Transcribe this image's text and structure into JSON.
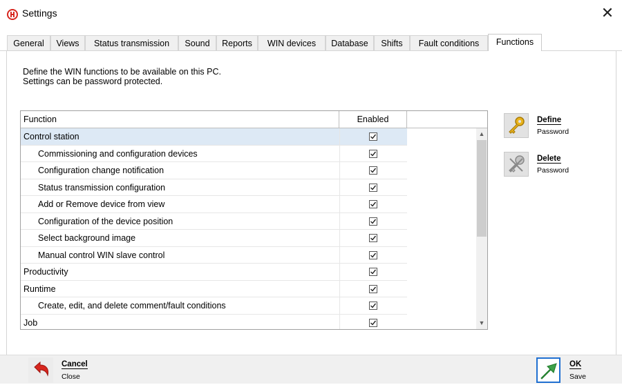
{
  "window": {
    "title": "Settings",
    "close_symbol": "✕"
  },
  "tabs": [
    {
      "label": "General"
    },
    {
      "label": "Views"
    },
    {
      "label": "Status transmission"
    },
    {
      "label": "Sound"
    },
    {
      "label": "Reports"
    },
    {
      "label": "WIN devices"
    },
    {
      "label": "Database"
    },
    {
      "label": "Shifts"
    },
    {
      "label": "Fault conditions"
    },
    {
      "label": "Functions",
      "active": true
    }
  ],
  "description": {
    "line1": "Define the WIN functions to be available on this PC.",
    "line2": "Settings can be password protected."
  },
  "table": {
    "headers": {
      "function": "Function",
      "enabled": "Enabled"
    },
    "rows": [
      {
        "label": "Control station",
        "child": false,
        "enabled": true,
        "selected": true
      },
      {
        "label": "Commissioning and configuration devices",
        "child": true,
        "enabled": true
      },
      {
        "label": "Configuration change notification",
        "child": true,
        "enabled": true
      },
      {
        "label": "Status transmission configuration",
        "child": true,
        "enabled": true
      },
      {
        "label": "Add or Remove device from view",
        "child": true,
        "enabled": true
      },
      {
        "label": "Configuration of the device position",
        "child": true,
        "enabled": true
      },
      {
        "label": "Select background image",
        "child": true,
        "enabled": true
      },
      {
        "label": "Manual control WIN slave control",
        "child": true,
        "enabled": true
      },
      {
        "label": "Productivity",
        "child": false,
        "enabled": true
      },
      {
        "label": "Runtime",
        "child": false,
        "enabled": true
      },
      {
        "label": "Create, edit, and delete comment/fault conditions",
        "child": true,
        "enabled": true
      },
      {
        "label": "Job",
        "child": false,
        "enabled": true
      }
    ]
  },
  "side_buttons": {
    "define": {
      "title": "Define",
      "sub": "Password",
      "icon": "key-icon"
    },
    "delete": {
      "title": "Delete",
      "sub": "Password",
      "icon": "delete-key-icon"
    }
  },
  "bottom_buttons": {
    "cancel": {
      "title": "Cancel",
      "sub": "Close",
      "icon": "undo-arrow-icon"
    },
    "ok": {
      "title": "OK",
      "sub": "Save",
      "icon": "save-arrow-icon"
    }
  },
  "colors": {
    "accent_red": "#d7261e",
    "selection": "#dde9f5",
    "ok_green": "#3ea14a",
    "ok_border": "#1f6fd1"
  }
}
